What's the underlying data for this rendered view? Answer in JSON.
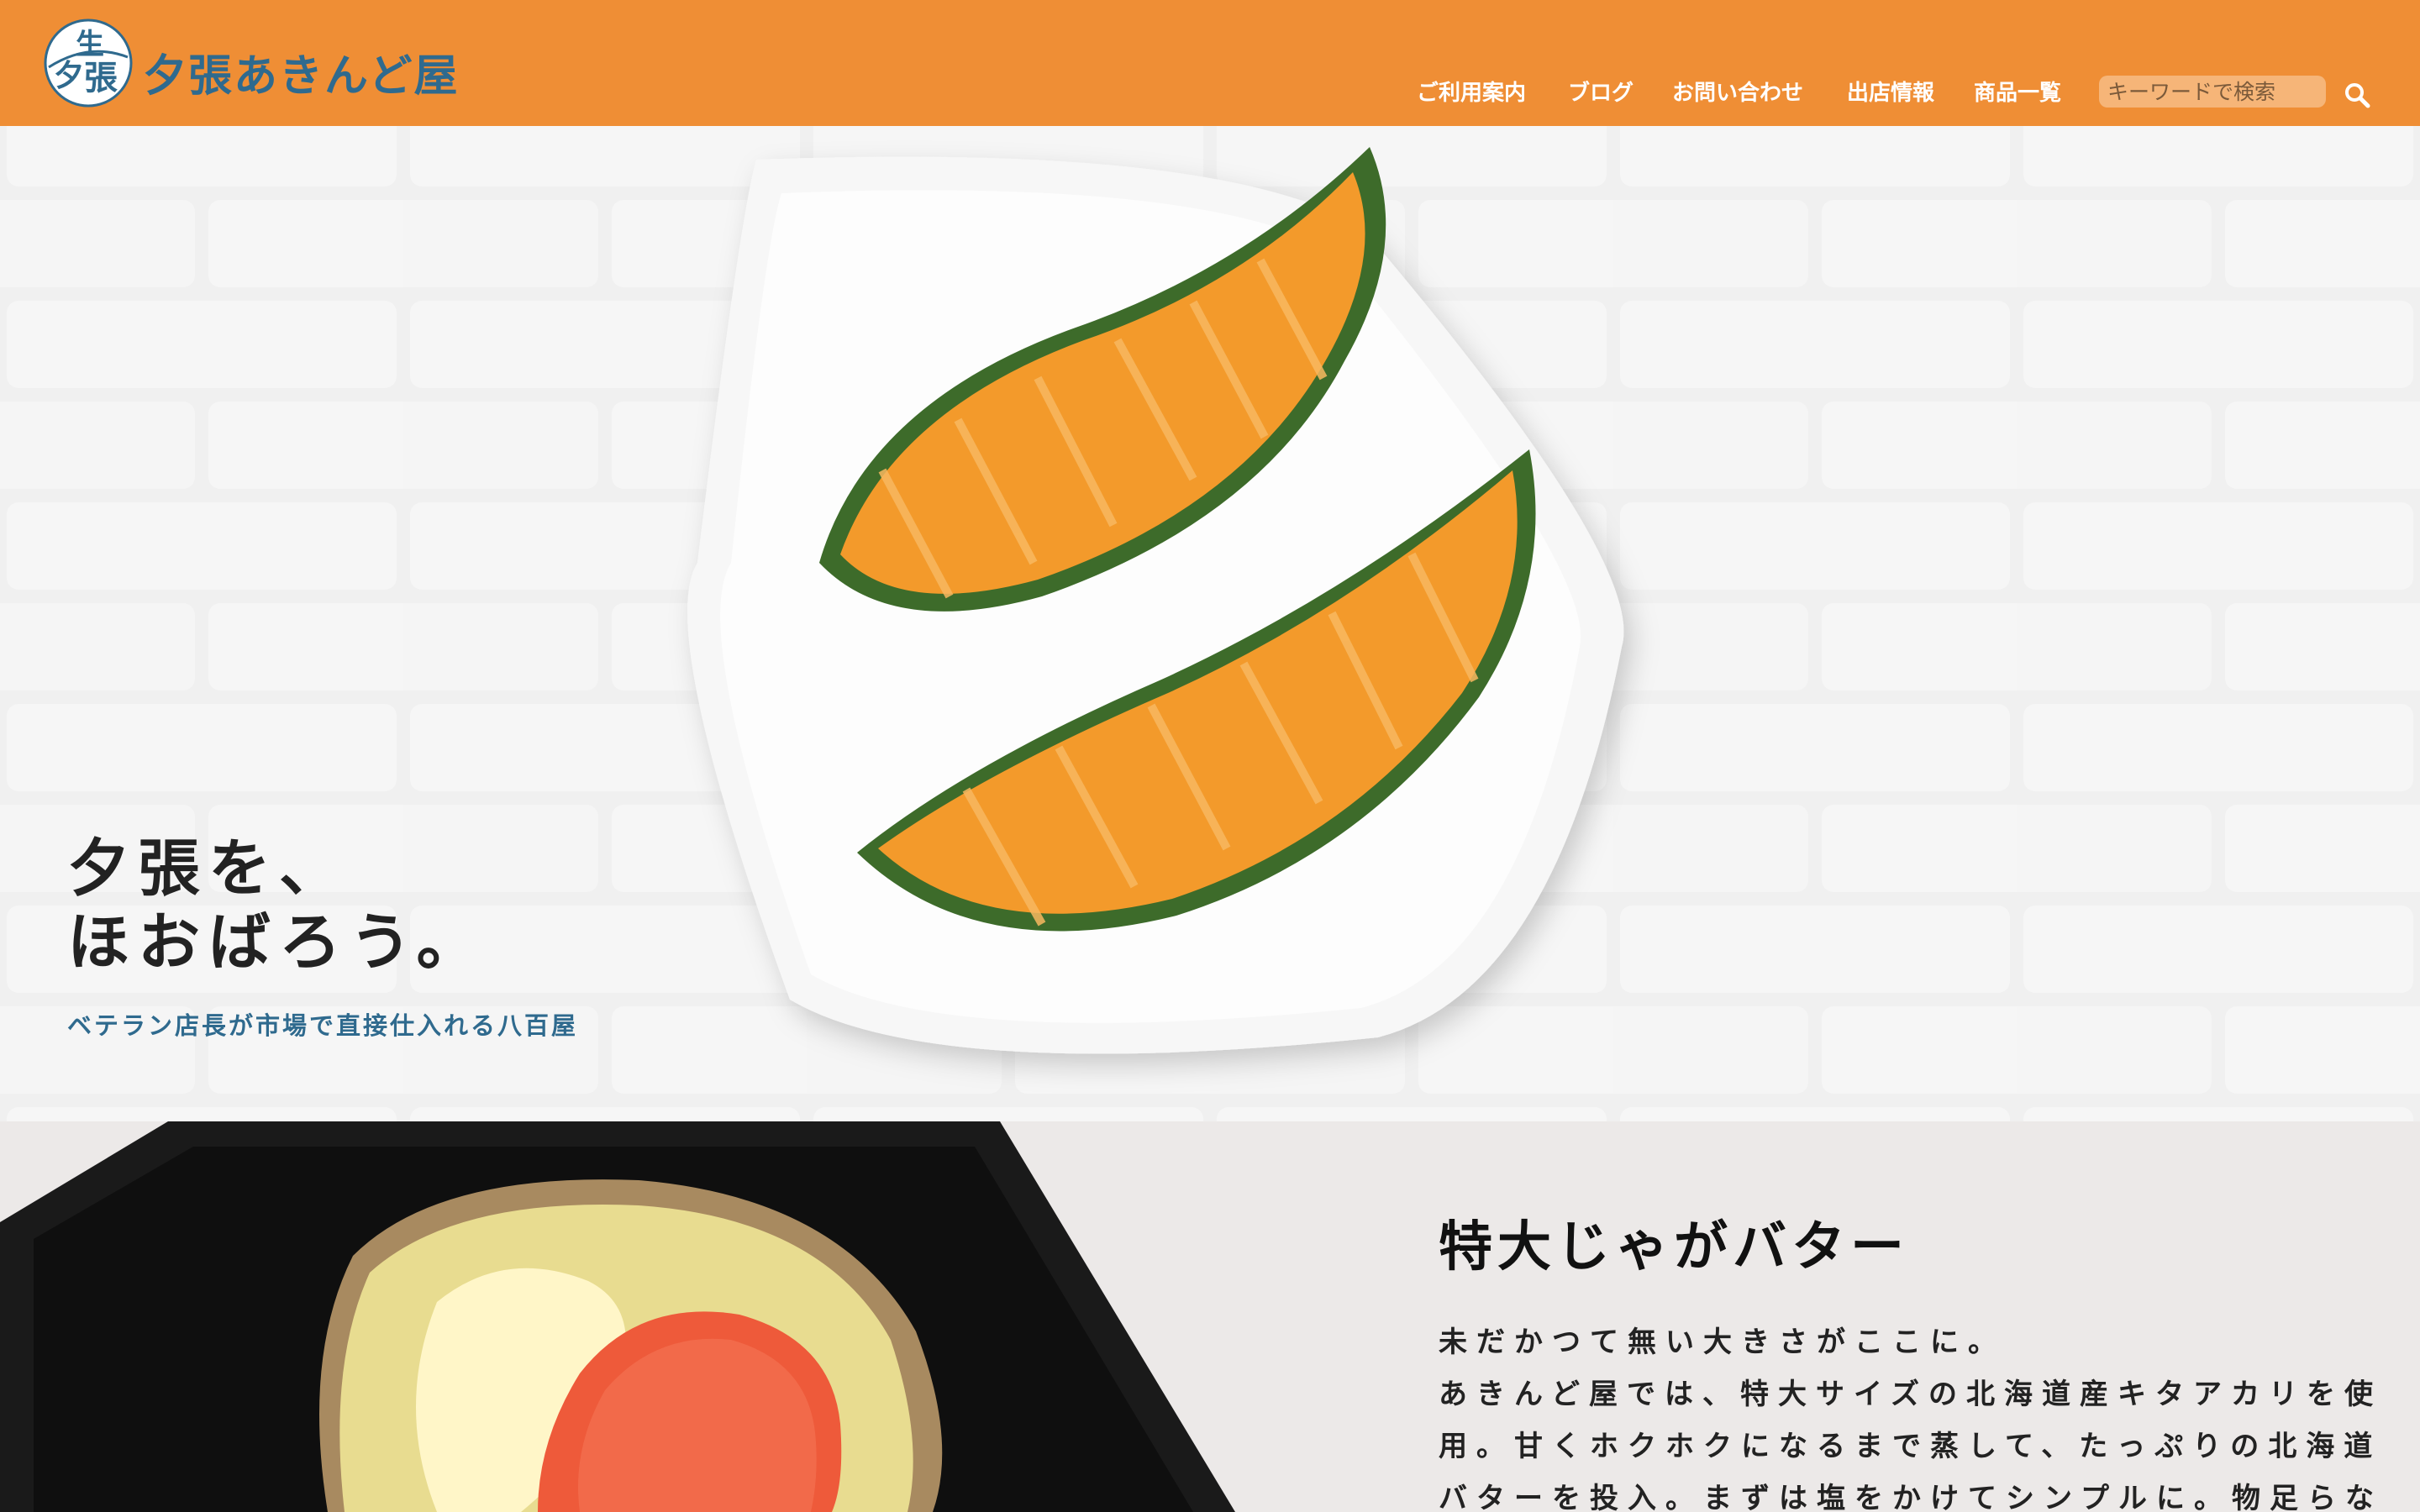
{
  "header": {
    "logo_glyphs": "生 夕 張",
    "site_name": "夕張あきんど屋",
    "nav": [
      {
        "label": "ご利用案内"
      },
      {
        "label": "ブログ"
      },
      {
        "label": "お問い合わせ"
      },
      {
        "label": "出店情報"
      },
      {
        "label": "商品一覧"
      }
    ],
    "search": {
      "placeholder": "キーワードで検索",
      "icon": "search-icon"
    }
  },
  "hero": {
    "title_line1": "夕張を、",
    "title_line2": "ほおばろう。",
    "subtitle": "ベテラン店長が市場で直接仕入れる八百屋",
    "image": "melon-on-plate"
  },
  "feature": {
    "image": "baked-potato-with-butter-and-mentaiko",
    "title": "特大じゃがバター",
    "lines": [
      "未だかつて無い大きさがここに。",
      "あきんど屋では、特大サイズの北海道産キタアカリを使",
      "用。甘くホクホクになるまで蒸して、たっぷりの北海道",
      "バターを投入。まずは塩をかけてシンプルに。物足らな"
    ]
  },
  "colors": {
    "accent": "#ef8e35",
    "brand_blue": "#2f6a8e",
    "hero_bg": "#eeeeee",
    "section_bg": "#ece9e8"
  }
}
